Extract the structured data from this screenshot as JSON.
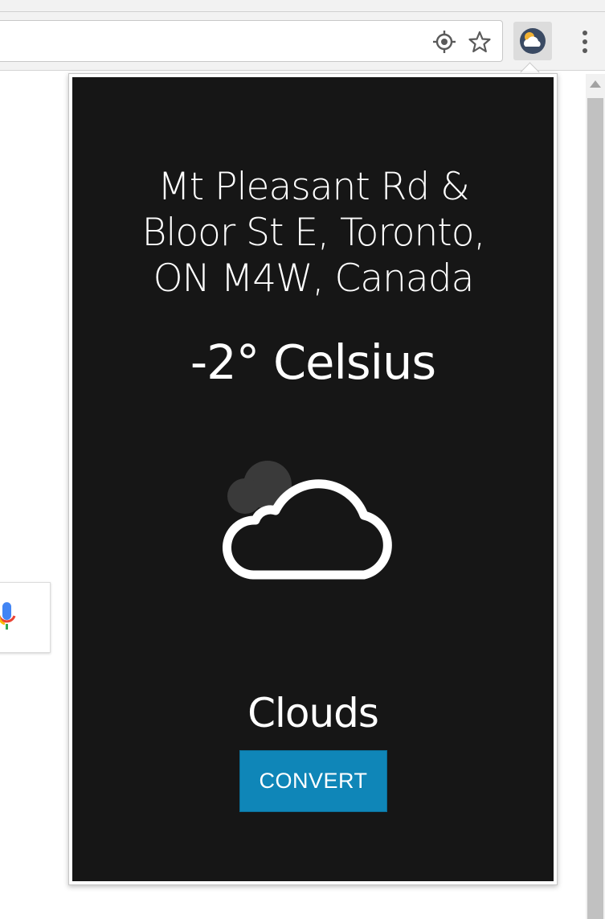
{
  "browser": {
    "location_icon": "location-target-icon",
    "bookmark_icon": "star-icon",
    "extension_icon": "weather-cloud-icon",
    "menu_icon": "vertical-dots-icon"
  },
  "search": {
    "mic_icon": "microphone-icon"
  },
  "popup": {
    "location": "Mt Pleasant Rd & Bloor St E, Toronto, ON M4W, Canada",
    "temperature": "-2° Celsius",
    "condition_icon": "cloud-icon",
    "condition": "Clouds",
    "convert_label": "CONVERT"
  },
  "colors": {
    "popup_background": "#161616",
    "convert_button": "#0f86b8",
    "text": "#ffffff"
  }
}
